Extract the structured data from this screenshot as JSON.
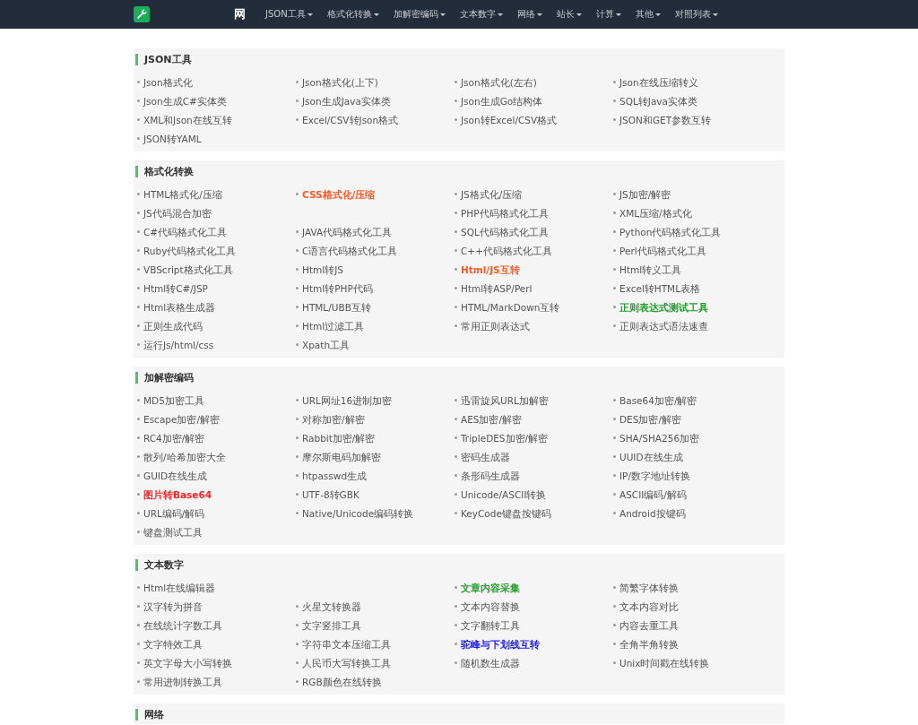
{
  "nav": {
    "logo_text": "网",
    "items": [
      {
        "label": "JSON工具"
      },
      {
        "label": "格式化转换"
      },
      {
        "label": "加解密编码"
      },
      {
        "label": "文本数字"
      },
      {
        "label": "网络"
      },
      {
        "label": "站长"
      },
      {
        "label": "计算"
      },
      {
        "label": "其他"
      },
      {
        "label": "对照列表"
      }
    ]
  },
  "sections": [
    {
      "title": "JSON工具",
      "items": [
        {
          "kind": "link",
          "label": "Json格式化"
        },
        {
          "kind": "link",
          "label": "Json格式化(上下)"
        },
        {
          "kind": "link",
          "label": "Json格式化(左右)"
        },
        {
          "kind": "link",
          "label": "Json在线压缩转义"
        },
        {
          "kind": "link",
          "label": "Json生成C#实体类"
        },
        {
          "kind": "link",
          "label": "Json生成Java实体类"
        },
        {
          "kind": "link",
          "label": "Json生成Go结构体"
        },
        {
          "kind": "link",
          "label": "SQL转Java实体类"
        },
        {
          "kind": "link",
          "label": "XML和Json在线互转"
        },
        {
          "kind": "link",
          "label": "Excel/CSV转Json格式"
        },
        {
          "kind": "link",
          "label": "Json转Excel/CSV格式"
        },
        {
          "kind": "link",
          "label": "JSON和GET参数互转"
        },
        {
          "kind": "link",
          "label": "JSON转YAML"
        }
      ]
    },
    {
      "title": "格式化转换",
      "items": [
        {
          "kind": "link",
          "label": "HTML格式化/压缩"
        },
        {
          "kind": "link",
          "label": "CSS格式化/压缩",
          "color": "#ff5722"
        },
        {
          "kind": "link",
          "label": "JS格式化/压缩"
        },
        {
          "kind": "link",
          "label": "JS加密/解密"
        },
        {
          "kind": "link",
          "label": "JS代码混合加密"
        },
        {
          "kind": "gap"
        },
        {
          "kind": "link",
          "label": "PHP代码格式化工具"
        },
        {
          "kind": "link",
          "label": "XML压缩/格式化"
        },
        {
          "kind": "link",
          "label": "C#代码格式化工具"
        },
        {
          "kind": "link",
          "label": "JAVA代码格式化工具"
        },
        {
          "kind": "link",
          "label": "SQL代码格式化工具"
        },
        {
          "kind": "link",
          "label": "Python代码格式化工具"
        },
        {
          "kind": "link",
          "label": "Ruby代码格式化工具"
        },
        {
          "kind": "link",
          "label": "C语言代码格式化工具"
        },
        {
          "kind": "link",
          "label": "C++代码格式化工具"
        },
        {
          "kind": "link",
          "label": "Perl代码格式化工具"
        },
        {
          "kind": "link",
          "label": "VBScript格式化工具"
        },
        {
          "kind": "link",
          "label": "Html转JS"
        },
        {
          "kind": "link",
          "label": "Html/JS互转",
          "color": "#ff5722"
        },
        {
          "kind": "link",
          "label": "Html转义工具"
        },
        {
          "kind": "link",
          "label": "Html转C#/JSP"
        },
        {
          "kind": "link",
          "label": "Html转PHP代码"
        },
        {
          "kind": "link",
          "label": "Html转ASP/Perl"
        },
        {
          "kind": "link",
          "label": "Excel转HTML表格"
        },
        {
          "kind": "link",
          "label": "Html表格生成器"
        },
        {
          "kind": "link",
          "label": "HTML/UBB互转"
        },
        {
          "kind": "link",
          "label": "HTML/MarkDown互转"
        },
        {
          "kind": "link",
          "label": "正则表达式测试工具",
          "color": "#239b2a"
        },
        {
          "kind": "link",
          "label": "正则生成代码"
        },
        {
          "kind": "link",
          "label": "Html过滤工具"
        },
        {
          "kind": "link",
          "label": "常用正则表达式"
        },
        {
          "kind": "link",
          "label": "正则表达式语法速查"
        },
        {
          "kind": "link",
          "label": "运行Js/html/css"
        },
        {
          "kind": "link",
          "label": "Xpath工具"
        }
      ]
    },
    {
      "title": "加解密编码",
      "items": [
        {
          "kind": "link",
          "label": "MD5加密工具"
        },
        {
          "kind": "link",
          "label": "URL网址16进制加密"
        },
        {
          "kind": "link",
          "label": "迅雷旋风URL加解密"
        },
        {
          "kind": "link",
          "label": "Base64加密/解密"
        },
        {
          "kind": "link",
          "label": "Escape加密/解密"
        },
        {
          "kind": "link",
          "label": "对称加密/解密"
        },
        {
          "kind": "link",
          "label": "AES加密/解密"
        },
        {
          "kind": "link",
          "label": "DES加密/解密"
        },
        {
          "kind": "link",
          "label": "RC4加密/解密"
        },
        {
          "kind": "link",
          "label": "Rabbit加密/解密"
        },
        {
          "kind": "link",
          "label": "TripleDES加密/解密"
        },
        {
          "kind": "link",
          "label": "SHA/SHA256加密"
        },
        {
          "kind": "link",
          "label": "散列/哈希加密大全"
        },
        {
          "kind": "link",
          "label": "摩尔斯电码加解密"
        },
        {
          "kind": "link",
          "label": "密码生成器"
        },
        {
          "kind": "link",
          "label": "UUID在线生成"
        },
        {
          "kind": "link",
          "label": "GUID在线生成"
        },
        {
          "kind": "link",
          "label": "htpasswd生成"
        },
        {
          "kind": "link",
          "label": "条形码生成器"
        },
        {
          "kind": "link",
          "label": "IP/数字地址转换"
        },
        {
          "kind": "link",
          "label": "图片转Base64",
          "color": "#ff2020"
        },
        {
          "kind": "link",
          "label": "UTF-8转GBK"
        },
        {
          "kind": "link",
          "label": "Unicode/ASCII转换"
        },
        {
          "kind": "link",
          "label": "ASCII编码/解码"
        },
        {
          "kind": "link",
          "label": "URL编码/解码"
        },
        {
          "kind": "link",
          "label": "Native/Unicode编码转换"
        },
        {
          "kind": "link",
          "label": "KeyCode键盘按键码"
        },
        {
          "kind": "link",
          "label": "Android按键码"
        },
        {
          "kind": "link",
          "label": "键盘测试工具"
        }
      ]
    },
    {
      "title": "文本数字",
      "items": [
        {
          "kind": "link",
          "label": "Html在线编辑器"
        },
        {
          "kind": "gap"
        },
        {
          "kind": "link",
          "label": "文章内容采集",
          "color": "#239b2a"
        },
        {
          "kind": "link",
          "label": "简繁字体转换"
        },
        {
          "kind": "link",
          "label": "汉字转为拼音"
        },
        {
          "kind": "link",
          "label": "火星文转换器"
        },
        {
          "kind": "link",
          "label": "文本内容替换"
        },
        {
          "kind": "link",
          "label": "文本内容对比"
        },
        {
          "kind": "link",
          "label": "在线统计字数工具"
        },
        {
          "kind": "link",
          "label": "文字竖排工具"
        },
        {
          "kind": "link",
          "label": "文字翻转工具"
        },
        {
          "kind": "link",
          "label": "内容去重工具"
        },
        {
          "kind": "link",
          "label": "文字特效工具"
        },
        {
          "kind": "link",
          "label": "字符串文本压缩工具"
        },
        {
          "kind": "link",
          "label": "驼峰与下划线互转",
          "color": "#2020ff"
        },
        {
          "kind": "link",
          "label": "全角半角转换"
        },
        {
          "kind": "link",
          "label": "英文字母大小写转换"
        },
        {
          "kind": "link",
          "label": "人民币大写转换工具"
        },
        {
          "kind": "link",
          "label": "随机数生成器"
        },
        {
          "kind": "link",
          "label": "Unix时间戳在线转换"
        },
        {
          "kind": "link",
          "label": "常用进制转换工具"
        },
        {
          "kind": "link",
          "label": "RGB颜色在线转换"
        }
      ]
    },
    {
      "title": "网络"
    }
  ]
}
